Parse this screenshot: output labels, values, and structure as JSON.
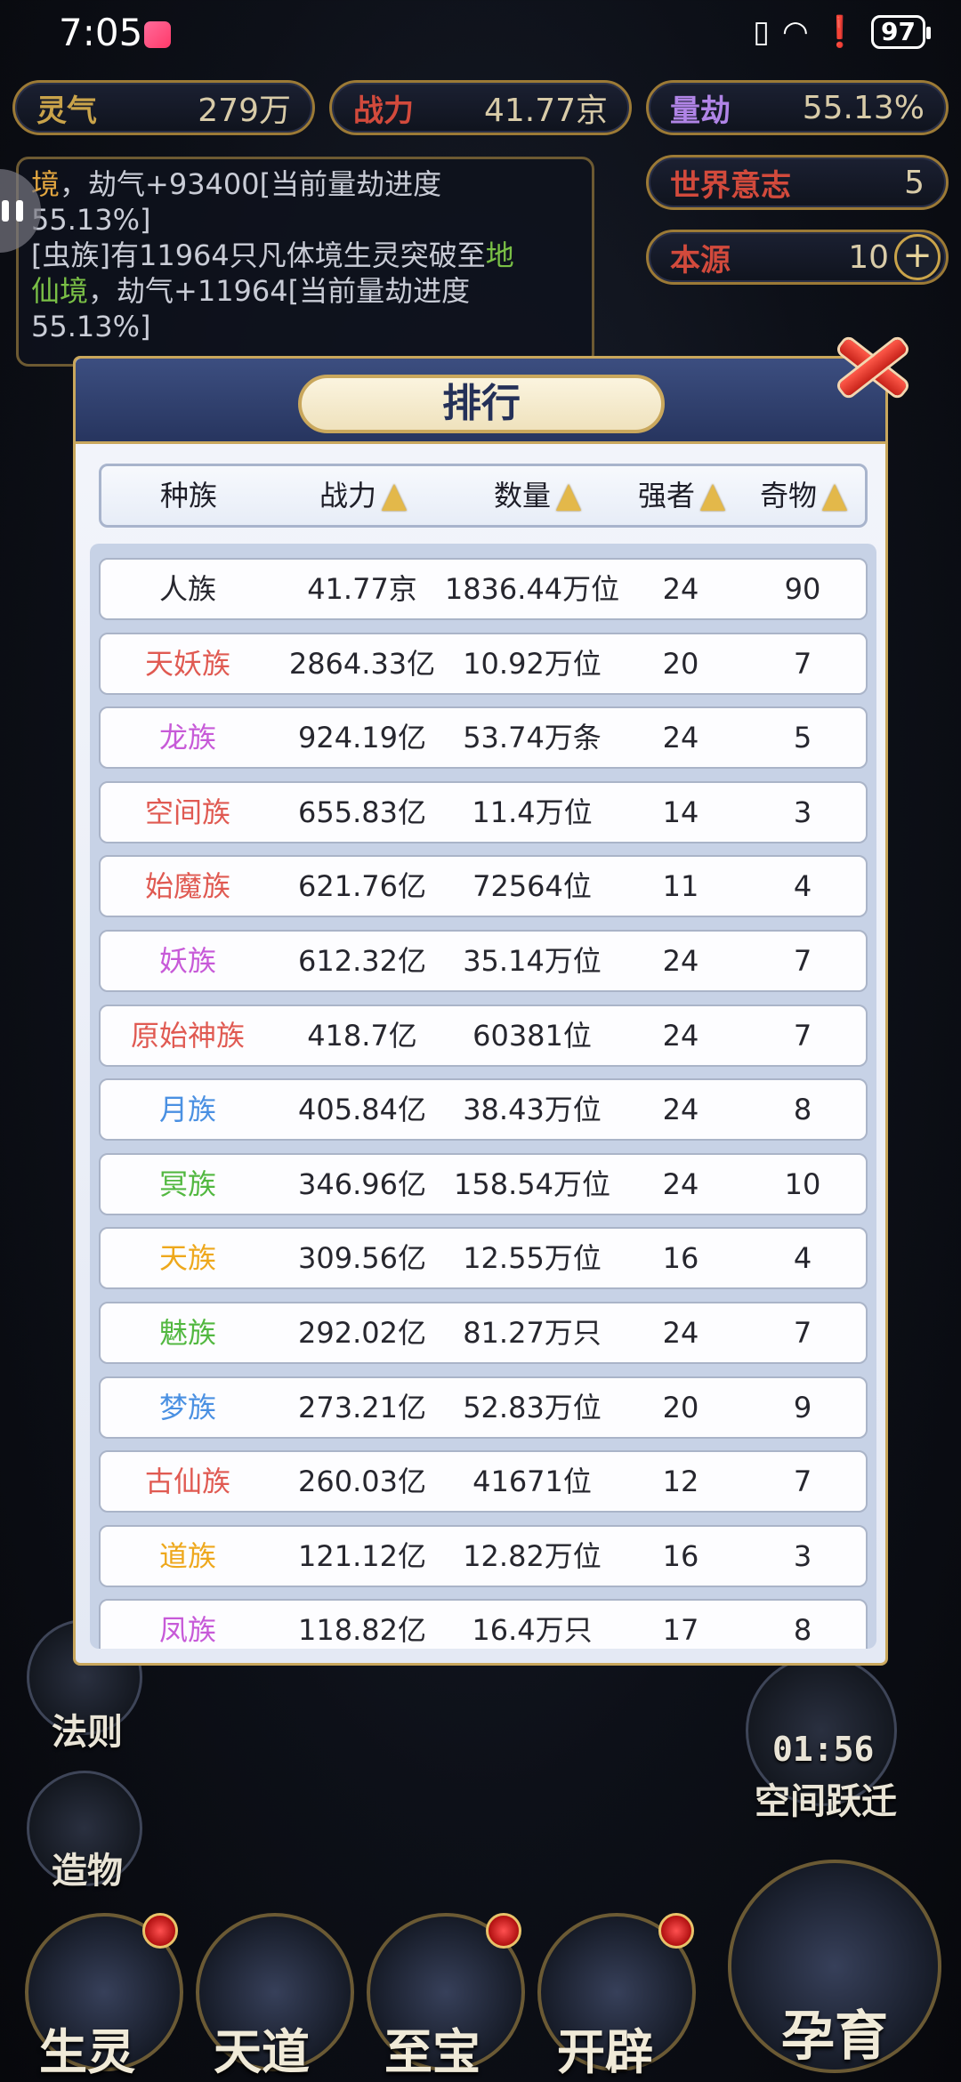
{
  "status_bar": {
    "time": "7:05",
    "battery": "97"
  },
  "hud": {
    "lingqi": {
      "label": "灵气",
      "value": "279万"
    },
    "zhanli": {
      "label": "战力",
      "value": "41.77京"
    },
    "liangjie": {
      "label": "量劫",
      "value": "55.13%"
    },
    "shijie": {
      "label": "世界意志",
      "value": "5"
    },
    "benyuan": {
      "label": "本源",
      "value": "10"
    }
  },
  "log": {
    "l1a": "境",
    "l1b": "，劫气+93400[当前量劫进度",
    "l2": "55.13%]",
    "l3a": "[虫族]有11964只凡体境生灵突破至",
    "l3b": "地",
    "l4a": "仙境",
    "l4b": "，劫气+11964[当前量劫进度",
    "l5": "55.13%]"
  },
  "side": {
    "fa_ze": "法则",
    "zao_wu": "造物",
    "timer": "01:56",
    "kongjian": "空间跃迁"
  },
  "bottom": {
    "shengling": "生灵",
    "tiandao": "天道",
    "zhibao": "至宝",
    "kaipi": "开辟",
    "yunyu": "孕育"
  },
  "ranking": {
    "title": "排行",
    "headers": {
      "race": "种族",
      "power": "战力",
      "count": "数量",
      "strong": "强者",
      "treasure": "奇物"
    },
    "colors": {
      "default": "#26262e",
      "red": "#e05a52",
      "purple": "#c75ad8",
      "blue": "#4a90e2",
      "green": "#52b840",
      "orange": "#eea81c"
    },
    "rows": [
      {
        "race": "人族",
        "power": "41.77京",
        "count": "1836.44万位",
        "strong": "24",
        "treasure": "90",
        "color": "#26262e"
      },
      {
        "race": "天妖族",
        "power": "2864.33亿",
        "count": "10.92万位",
        "strong": "20",
        "treasure": "7",
        "color": "#e05a52"
      },
      {
        "race": "龙族",
        "power": "924.19亿",
        "count": "53.74万条",
        "strong": "24",
        "treasure": "5",
        "color": "#c75ad8"
      },
      {
        "race": "空间族",
        "power": "655.83亿",
        "count": "11.4万位",
        "strong": "14",
        "treasure": "3",
        "color": "#e05a52"
      },
      {
        "race": "始魔族",
        "power": "621.76亿",
        "count": "72564位",
        "strong": "11",
        "treasure": "4",
        "color": "#e05a52"
      },
      {
        "race": "妖族",
        "power": "612.32亿",
        "count": "35.14万位",
        "strong": "24",
        "treasure": "7",
        "color": "#c75ad8"
      },
      {
        "race": "原始神族",
        "power": "418.7亿",
        "count": "60381位",
        "strong": "24",
        "treasure": "7",
        "color": "#e05a52"
      },
      {
        "race": "月族",
        "power": "405.84亿",
        "count": "38.43万位",
        "strong": "24",
        "treasure": "8",
        "color": "#4a90e2"
      },
      {
        "race": "冥族",
        "power": "346.96亿",
        "count": "158.54万位",
        "strong": "24",
        "treasure": "10",
        "color": "#52b840"
      },
      {
        "race": "天族",
        "power": "309.56亿",
        "count": "12.55万位",
        "strong": "16",
        "treasure": "4",
        "color": "#eea81c"
      },
      {
        "race": "魅族",
        "power": "292.02亿",
        "count": "81.27万只",
        "strong": "24",
        "treasure": "7",
        "color": "#52b840"
      },
      {
        "race": "梦族",
        "power": "273.21亿",
        "count": "52.83万位",
        "strong": "20",
        "treasure": "9",
        "color": "#4a90e2"
      },
      {
        "race": "古仙族",
        "power": "260.03亿",
        "count": "41671位",
        "strong": "12",
        "treasure": "7",
        "color": "#e05a52"
      },
      {
        "race": "道族",
        "power": "121.12亿",
        "count": "12.82万位",
        "strong": "16",
        "treasure": "3",
        "color": "#eea81c"
      },
      {
        "race": "凤族",
        "power": "118.82亿",
        "count": "16.4万只",
        "strong": "17",
        "treasure": "8",
        "color": "#c75ad8"
      }
    ]
  }
}
